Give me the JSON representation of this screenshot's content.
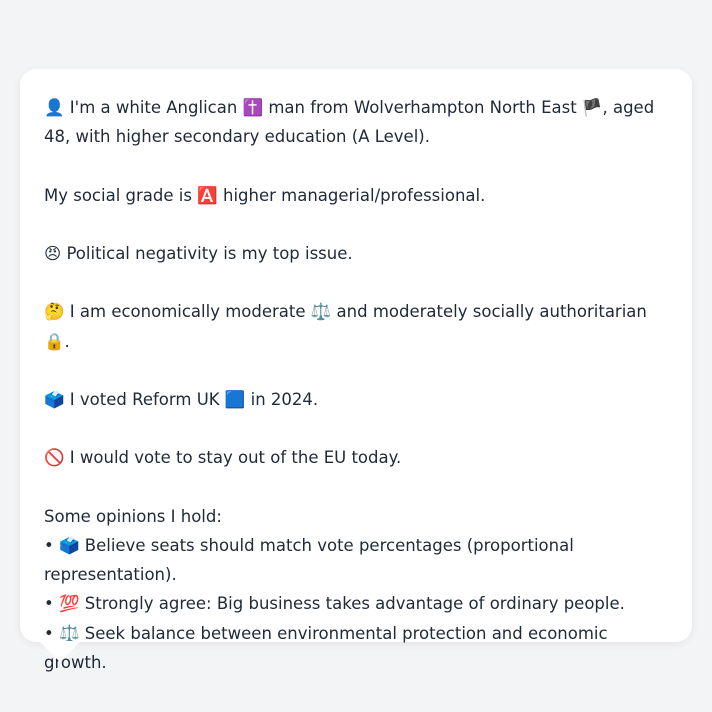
{
  "card": {
    "intro": "👤 I'm a white Anglican ✝️ man from Wolverhampton North East 🏴, aged 48, with higher secondary education (A Level).",
    "social_grade": "My social grade is 🅰️ higher managerial/professional.",
    "top_issue": "😠 Political negativity is my top issue.",
    "ideology": "🤔 I am economically moderate ⚖️ and moderately socially authoritarian 🔒.",
    "vote_2024": "🗳️ I voted Reform UK 🟦 in 2024.",
    "eu_vote": "🚫 I would vote to stay out of the EU today.",
    "opinions_heading": "Some opinions I hold:",
    "opinions": [
      "• 🗳️ Believe seats should match vote percentages (proportional representation).",
      "• 💯 Strongly agree: Big business takes advantage of ordinary people.",
      "• ⚖️ Seek balance between environmental protection and economic growth."
    ]
  }
}
